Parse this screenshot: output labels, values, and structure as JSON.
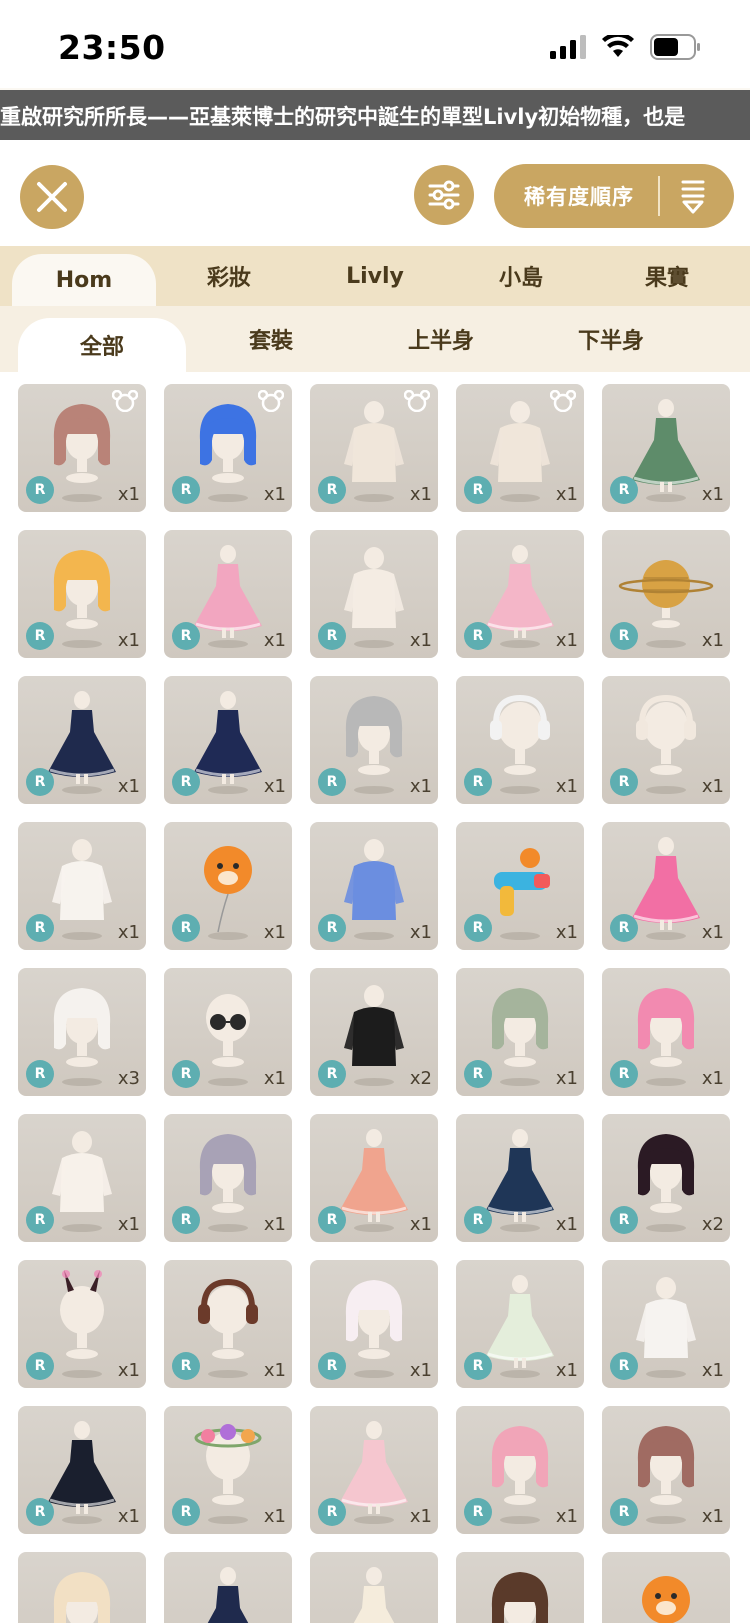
{
  "status": {
    "time": "23:50"
  },
  "ticker": {
    "text": "重啟研究所所長——亞基萊博士的研究中誕生的單型Livly初始物種，也是"
  },
  "toolbar": {
    "sort_label": "稀有度順序"
  },
  "tabs_primary": [
    {
      "label": "Hom",
      "active": true
    },
    {
      "label": "彩妝",
      "active": false
    },
    {
      "label": "Livly",
      "active": false
    },
    {
      "label": "小島",
      "active": false
    },
    {
      "label": "果實",
      "active": false
    }
  ],
  "tabs_secondary": [
    {
      "label": "全部",
      "active": true
    },
    {
      "label": "套裝",
      "active": false
    },
    {
      "label": "上半身",
      "active": false
    },
    {
      "label": "下半身",
      "active": false
    }
  ],
  "items": [
    {
      "rarity": "R",
      "qty": "x1",
      "icon": "hair-brown-bob-icon",
      "color": "#b98378",
      "bear": true,
      "shape": "hair"
    },
    {
      "rarity": "R",
      "qty": "x1",
      "icon": "hair-blue-bob-icon",
      "color": "#3d73e3",
      "bear": true,
      "shape": "hair"
    },
    {
      "rarity": "R",
      "qty": "x1",
      "icon": "body-cream-orange-tail-icon",
      "color": "#f0e6da",
      "bear": true,
      "shape": "body"
    },
    {
      "rarity": "R",
      "qty": "x1",
      "icon": "body-cream-orange-tail-icon",
      "color": "#f0e6da",
      "bear": true,
      "shape": "body"
    },
    {
      "rarity": "R",
      "qty": "x1",
      "icon": "green-dress-icon",
      "color": "#5e8c6a",
      "bear": false,
      "shape": "dress"
    },
    {
      "rarity": "R",
      "qty": "x1",
      "icon": "hair-orange-wavy-icon",
      "color": "#f3b64e",
      "bear": false,
      "shape": "hair"
    },
    {
      "rarity": "R",
      "qty": "x1",
      "icon": "pink-dress-icon",
      "color": "#f2a6c0",
      "bear": false,
      "shape": "dress"
    },
    {
      "rarity": "R",
      "qty": "x1",
      "icon": "cream-sweater-icon",
      "color": "#f4ece3",
      "bear": false,
      "shape": "body"
    },
    {
      "rarity": "R",
      "qty": "x1",
      "icon": "pink-cake-dress-icon",
      "color": "#f4b6c8",
      "bear": false,
      "shape": "dress"
    },
    {
      "rarity": "R",
      "qty": "x1",
      "icon": "planet-hat-icon",
      "color": "#d8a244",
      "bear": false,
      "shape": "planet"
    },
    {
      "rarity": "R",
      "qty": "x1",
      "icon": "navy-cape-icon",
      "color": "#1f2a4d",
      "bear": false,
      "shape": "dress"
    },
    {
      "rarity": "R",
      "qty": "x1",
      "icon": "navy-skirt-icon",
      "color": "#1f2a55",
      "bear": false,
      "shape": "dress"
    },
    {
      "rarity": "R",
      "qty": "x1",
      "icon": "hair-silver-long-icon",
      "color": "#b8b8b8",
      "bear": false,
      "shape": "hair"
    },
    {
      "rarity": "R",
      "qty": "x1",
      "icon": "headphones-white-icon",
      "color": "#f2f2f2",
      "bear": false,
      "shape": "head"
    },
    {
      "rarity": "R",
      "qty": "x1",
      "icon": "sparkle-face-icon",
      "color": "#f1e8de",
      "bear": false,
      "shape": "head"
    },
    {
      "rarity": "R",
      "qty": "x1",
      "icon": "angel-wings-icon",
      "color": "#f7f3ee",
      "bear": false,
      "shape": "body"
    },
    {
      "rarity": "R",
      "qty": "x1",
      "icon": "orange-pet-balloon-icon",
      "color": "#f28a2a",
      "bear": false,
      "shape": "balloon"
    },
    {
      "rarity": "R",
      "qty": "x1",
      "icon": "blue-sparkle-aura-icon",
      "color": "#6b8ee0",
      "bear": false,
      "shape": "body"
    },
    {
      "rarity": "R",
      "qty": "x1",
      "icon": "water-gun-icon",
      "color": "#f2b93b",
      "bear": false,
      "shape": "gun"
    },
    {
      "rarity": "R",
      "qty": "x1",
      "icon": "pink-flower-float-icon",
      "color": "#f26fa4",
      "bear": false,
      "shape": "dress"
    },
    {
      "rarity": "R",
      "qty": "x3",
      "icon": "hair-white-curly-icon",
      "color": "#f5f2ee",
      "bear": false,
      "shape": "hair"
    },
    {
      "rarity": "R",
      "qty": "x1",
      "icon": "round-sunglasses-icon",
      "color": "#2a2a2a",
      "bear": false,
      "shape": "glasses"
    },
    {
      "rarity": "R",
      "qty": "x2",
      "icon": "checker-jacket-icon",
      "color": "#1c1c1c",
      "bear": false,
      "shape": "body"
    },
    {
      "rarity": "R",
      "qty": "x1",
      "icon": "hair-green-long-icon",
      "color": "#a5b49c",
      "bear": false,
      "shape": "hair"
    },
    {
      "rarity": "R",
      "qty": "x1",
      "icon": "hair-pink-side-icon",
      "color": "#f28ab0",
      "bear": false,
      "shape": "hair"
    },
    {
      "rarity": "R",
      "qty": "x1",
      "icon": "white-ribbon-outfit-icon",
      "color": "#f7f1ea",
      "bear": false,
      "shape": "body"
    },
    {
      "rarity": "R",
      "qty": "x1",
      "icon": "hair-lavender-braid-icon",
      "color": "#a8a2b6",
      "bear": false,
      "shape": "hair"
    },
    {
      "rarity": "R",
      "qty": "x1",
      "icon": "peach-dress-icon",
      "color": "#f0a48e",
      "bear": false,
      "shape": "dress"
    },
    {
      "rarity": "R",
      "qty": "x1",
      "icon": "navy-gown-icon",
      "color": "#1f3657",
      "bear": false,
      "shape": "dress"
    },
    {
      "rarity": "R",
      "qty": "x2",
      "icon": "hair-black-heart-icon",
      "color": "#2b1a24",
      "bear": false,
      "shape": "hair"
    },
    {
      "rarity": "R",
      "qty": "x1",
      "icon": "bunny-horns-icon",
      "color": "#3a1f26",
      "bear": false,
      "shape": "horns"
    },
    {
      "rarity": "R",
      "qty": "x1",
      "icon": "brown-headphones-icon",
      "color": "#6b3a2a",
      "bear": false,
      "shape": "head"
    },
    {
      "rarity": "R",
      "qty": "x1",
      "icon": "white-veil-icon",
      "color": "#f7eef2",
      "bear": false,
      "shape": "hair"
    },
    {
      "rarity": "R",
      "qty": "x1",
      "icon": "green-white-dress-icon",
      "color": "#e4eedb",
      "bear": false,
      "shape": "dress"
    },
    {
      "rarity": "R",
      "qty": "x1",
      "icon": "cloud-top-icon",
      "color": "#f6f3f0",
      "bear": false,
      "shape": "body"
    },
    {
      "rarity": "R",
      "qty": "x1",
      "icon": "black-star-dress-icon",
      "color": "#1a1f2e",
      "bear": false,
      "shape": "dress"
    },
    {
      "rarity": "R",
      "qty": "x1",
      "icon": "flower-crown-icon",
      "color": "#b06fd8",
      "bear": false,
      "shape": "crown"
    },
    {
      "rarity": "R",
      "qty": "x1",
      "icon": "pink-sheer-dress-icon",
      "color": "#f5c6cf",
      "bear": false,
      "shape": "dress"
    },
    {
      "rarity": "R",
      "qty": "x1",
      "icon": "hair-pink-braid-icon",
      "color": "#f1a5b8",
      "bear": false,
      "shape": "hair"
    },
    {
      "rarity": "R",
      "qty": "x1",
      "icon": "hair-brown-bob-highlight-icon",
      "color": "#a06b62",
      "bear": false,
      "shape": "hair"
    },
    {
      "rarity": "",
      "qty": "",
      "icon": "hair-cream-buns-icon",
      "color": "#f2e0c4",
      "bear": false,
      "shape": "hair"
    },
    {
      "rarity": "",
      "qty": "",
      "icon": "navy-coat-icon",
      "color": "#1f2a4d",
      "bear": false,
      "shape": "dress"
    },
    {
      "rarity": "",
      "qty": "",
      "icon": "cream-gown-icon",
      "color": "#f5ecdc",
      "bear": false,
      "shape": "dress"
    },
    {
      "rarity": "",
      "qty": "",
      "icon": "hair-dark-brown-icon",
      "color": "#5a3a2a",
      "bear": false,
      "shape": "hair"
    },
    {
      "rarity": "",
      "qty": "",
      "icon": "orange-pet-icon",
      "color": "#f28a2a",
      "bear": false,
      "shape": "balloon"
    }
  ]
}
